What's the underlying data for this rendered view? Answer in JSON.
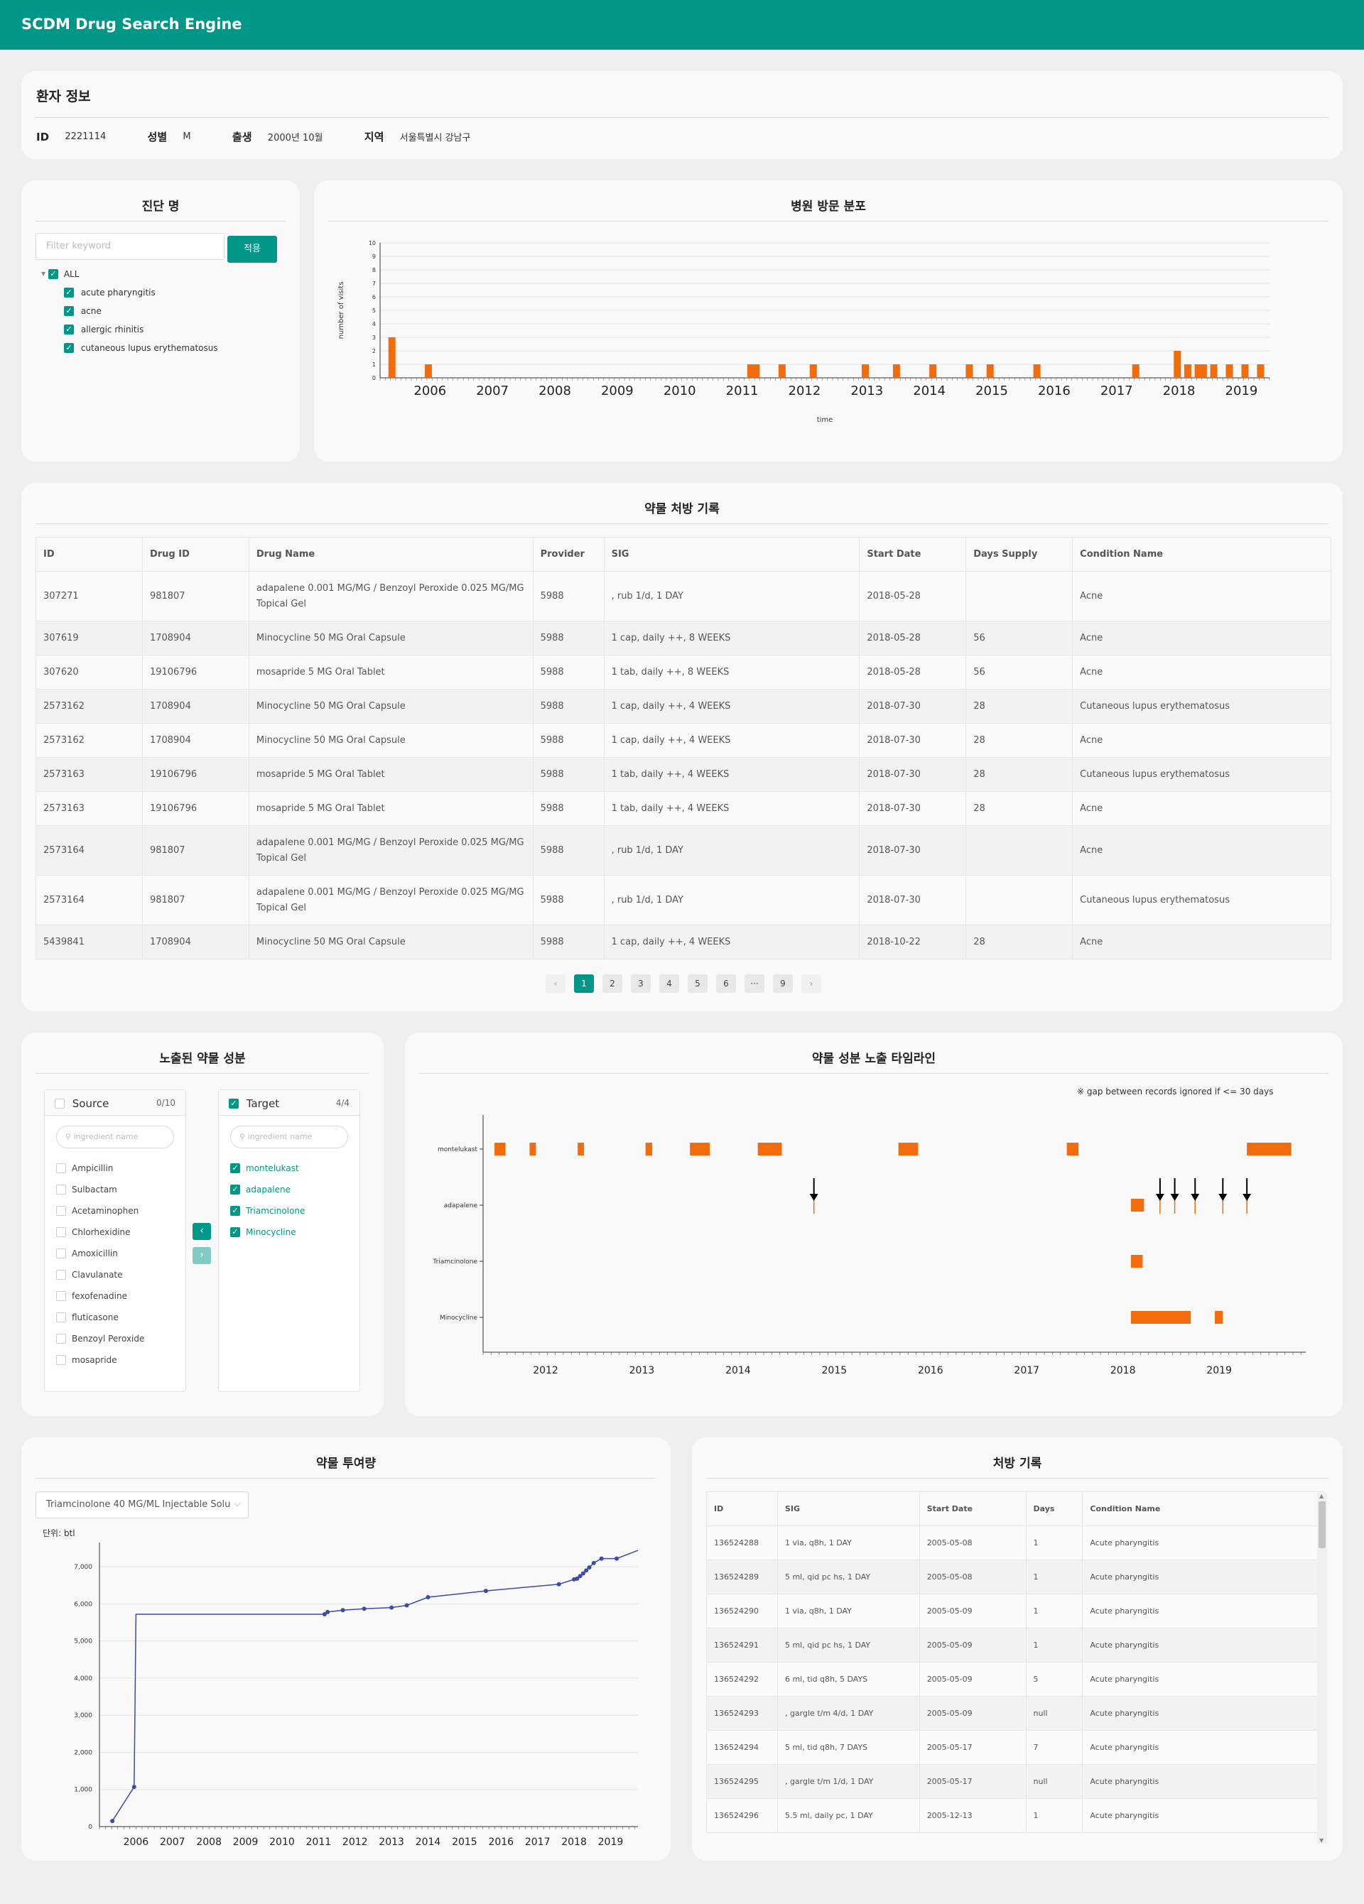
{
  "app": {
    "title": "SCDM Drug Search Engine"
  },
  "patient": {
    "title": "환자 정보",
    "id_label": "ID",
    "id": "2221114",
    "sex_label": "성별",
    "sex": "M",
    "birth_label": "출생",
    "birth": "2000년 10월",
    "region_label": "지역",
    "region": "서울특별시 강남구"
  },
  "diagnosis": {
    "title": "진단 명",
    "filter_placeholder": "Filter keyword",
    "apply_label": "적용",
    "all_label": "ALL",
    "items": [
      "acute pharyngitis",
      "acne",
      "allergic rhinitis",
      "cutaneous lupus erythematosus"
    ]
  },
  "visits": {
    "title": "병원 방문 분포"
  },
  "prescriptions": {
    "title": "약물 처방 기록",
    "columns": [
      "ID",
      "Drug ID",
      "Drug Name",
      "Provider",
      "SIG",
      "Start Date",
      "Days Supply",
      "Condition Name"
    ],
    "rows": [
      [
        "307271",
        "981807",
        "adapalene 0.001 MG/MG / Benzoyl Peroxide 0.025 MG/MG Topical Gel",
        "5988",
        ", rub 1/d, 1 DAY",
        "2018-05-28",
        "",
        "Acne"
      ],
      [
        "307619",
        "1708904",
        "Minocycline 50 MG Oral Capsule",
        "5988",
        "1 cap, daily ++, 8 WEEKS",
        "2018-05-28",
        "56",
        "Acne"
      ],
      [
        "307620",
        "19106796",
        "mosapride 5 MG Oral Tablet",
        "5988",
        "1 tab, daily ++, 8 WEEKS",
        "2018-05-28",
        "56",
        "Acne"
      ],
      [
        "2573162",
        "1708904",
        "Minocycline 50 MG Oral Capsule",
        "5988",
        "1 cap, daily ++, 4 WEEKS",
        "2018-07-30",
        "28",
        "Cutaneous lupus erythematosus"
      ],
      [
        "2573162",
        "1708904",
        "Minocycline 50 MG Oral Capsule",
        "5988",
        "1 cap, daily ++, 4 WEEKS",
        "2018-07-30",
        "28",
        "Acne"
      ],
      [
        "2573163",
        "19106796",
        "mosapride 5 MG Oral Tablet",
        "5988",
        "1 tab, daily ++, 4 WEEKS",
        "2018-07-30",
        "28",
        "Cutaneous lupus erythematosus"
      ],
      [
        "2573163",
        "19106796",
        "mosapride 5 MG Oral Tablet",
        "5988",
        "1 tab, daily ++, 4 WEEKS",
        "2018-07-30",
        "28",
        "Acne"
      ],
      [
        "2573164",
        "981807",
        "adapalene 0.001 MG/MG / Benzoyl Peroxide 0.025 MG/MG Topical Gel",
        "5988",
        ", rub 1/d, 1 DAY",
        "2018-07-30",
        "",
        "Acne"
      ],
      [
        "2573164",
        "981807",
        "adapalene 0.001 MG/MG / Benzoyl Peroxide 0.025 MG/MG Topical Gel",
        "5988",
        ", rub 1/d, 1 DAY",
        "2018-07-30",
        "",
        "Cutaneous lupus erythematosus"
      ],
      [
        "5439841",
        "1708904",
        "Minocycline 50 MG Oral Capsule",
        "5988",
        "1 cap, daily ++, 4 WEEKS",
        "2018-10-22",
        "28",
        "Acne"
      ]
    ],
    "pagination": {
      "prev": "‹",
      "pages": [
        "1",
        "2",
        "3",
        "4",
        "5",
        "6",
        "···",
        "9"
      ],
      "current": "1",
      "next": "›"
    }
  },
  "ingredients": {
    "title": "노출된 약물 성분",
    "source": {
      "label": "Source",
      "count": "0/10",
      "placeholder": "ingredient name",
      "items": [
        "Ampicillin",
        "Sulbactam",
        "Acetaminophen",
        "Chlorhexidine",
        "Amoxicillin",
        "Clavulanate",
        "fexofenadine",
        "fluticasone",
        "Benzoyl Peroxide",
        "mosapride"
      ]
    },
    "target": {
      "label": "Target",
      "count": "4/4",
      "placeholder": "ingredient name",
      "items": [
        "montelukast",
        "adapalene",
        "Triamcinolone",
        "Minocycline"
      ]
    }
  },
  "timeline": {
    "title": "약물 성분 노출 타임라인",
    "note": "※ gap between records ignored if <= 30 days"
  },
  "dosage": {
    "title": "약물 투여량",
    "selected_drug": "Triamcinolone 40 MG/ML Injectable Solu",
    "unit": "단위: btl"
  },
  "history": {
    "title": "처방 기록",
    "columns": [
      "ID",
      "SIG",
      "Start Date",
      "Days",
      "Condition Name"
    ],
    "rows": [
      [
        "136524288",
        "1 via, q8h, 1 DAY",
        "2005-05-08",
        "1",
        "Acute pharyngitis"
      ],
      [
        "136524289",
        "5 ml, qid pc hs, 1 DAY",
        "2005-05-08",
        "1",
        "Acute pharyngitis"
      ],
      [
        "136524290",
        "1 via, q8h, 1 DAY",
        "2005-05-09",
        "1",
        "Acute pharyngitis"
      ],
      [
        "136524291",
        "5 ml, qid pc hs, 1 DAY",
        "2005-05-09",
        "1",
        "Acute pharyngitis"
      ],
      [
        "136524292",
        "6 ml, tid q8h, 5 DAYS",
        "2005-05-09",
        "5",
        "Acute pharyngitis"
      ],
      [
        "136524293",
        ", gargle t/m 4/d, 1 DAY",
        "2005-05-09",
        "null",
        "Acute pharyngitis"
      ],
      [
        "136524294",
        "5 ml, tid q8h, 7 DAYS",
        "2005-05-17",
        "7",
        "Acute pharyngitis"
      ],
      [
        "136524295",
        ", gargle t/m 1/d, 1 DAY",
        "2005-05-17",
        "null",
        "Acute pharyngitis"
      ],
      [
        "136524296",
        "5.5 ml, daily pc, 1 DAY",
        "2005-12-13",
        "1",
        "Acute pharyngitis"
      ]
    ]
  },
  "colors": {
    "header": "#009688",
    "bar": "#f36c0c",
    "line": "#3b4ba6"
  },
  "chart_data": [
    {
      "type": "bar",
      "title": "",
      "xlabel": "time",
      "ylabel": "number of visits",
      "ylim": [
        0,
        10
      ],
      "x_ticks": [
        "2006",
        "2007",
        "2008",
        "2009",
        "2010",
        "2011",
        "2012",
        "2013",
        "2014",
        "2015",
        "2016",
        "2017",
        "2018",
        "2019"
      ],
      "x": [
        "2005-05",
        "2005-12",
        "2011-02",
        "2011-03",
        "2011-08",
        "2012-02",
        "2012-12",
        "2013-06",
        "2014-01",
        "2014-08",
        "2014-12",
        "2015-09",
        "2017-04",
        "2017-12",
        "2018-02",
        "2018-04",
        "2018-05",
        "2018-07",
        "2018-10",
        "2019-01",
        "2019-04"
      ],
      "values": [
        3,
        1,
        1,
        1,
        1,
        1,
        1,
        1,
        1,
        1,
        1,
        1,
        1,
        2,
        1,
        1,
        1,
        1,
        1,
        1,
        1
      ]
    },
    {
      "type": "timeline",
      "title": "",
      "x_ticks": [
        "2012",
        "2013",
        "2014",
        "2015",
        "2016",
        "2017",
        "2018",
        "2019"
      ],
      "categories": [
        "montelukast",
        "adapalene",
        "Triamcinolone",
        "Minocycline"
      ],
      "series": [
        {
          "name": "montelukast",
          "intervals": [
            [
              "2011-06-20",
              "2011-08-01"
            ],
            [
              "2011-11-01",
              "2011-11-25"
            ],
            [
              "2012-05-01",
              "2012-05-25"
            ],
            [
              "2013-01-15",
              "2013-02-10"
            ],
            [
              "2013-07-01",
              "2013-09-15"
            ],
            [
              "2014-03-15",
              "2014-06-15"
            ],
            [
              "2015-09-01",
              "2015-11-15"
            ],
            [
              "2017-06-01",
              "2017-07-15"
            ],
            [
              "2019-04-15",
              "2019-10-01"
            ]
          ]
        },
        {
          "name": "adapalene",
          "intervals": [
            [
              "2018-02-01",
              "2018-03-20"
            ]
          ],
          "markers": [
            "2014-10-15",
            "2018-05-20",
            "2018-07-15",
            "2018-10-01",
            "2019-01-15",
            "2019-04-15"
          ]
        },
        {
          "name": "Triamcinolone",
          "intervals": [
            [
              "2018-02-01",
              "2018-03-15"
            ]
          ]
        },
        {
          "name": "Minocycline",
          "intervals": [
            [
              "2018-02-01",
              "2018-09-15"
            ],
            [
              "2018-12-15",
              "2019-01-15"
            ]
          ]
        }
      ]
    },
    {
      "type": "line",
      "title": "",
      "ylabel": "",
      "unit": "단위: btl",
      "ylim": [
        0,
        7500
      ],
      "y_ticks": [
        "0",
        "1,000",
        "2,000",
        "3,000",
        "4,000",
        "5,000",
        "6,000",
        "7,000"
      ],
      "x_ticks": [
        "2006",
        "2007",
        "2008",
        "2009",
        "2010",
        "2011",
        "2012",
        "2013",
        "2014",
        "2015",
        "2016",
        "2017",
        "2018",
        "2019"
      ],
      "x": [
        "2005-05-08",
        "2005-12-13",
        "2006-01-01",
        "2011-03-01",
        "2011-04-01",
        "2011-09-01",
        "2012-04-01",
        "2013-01-01",
        "2013-06-01",
        "2014-01-01",
        "2015-08-01",
        "2017-08-01",
        "2018-01-01",
        "2018-02-01",
        "2018-03-01",
        "2018-04-01",
        "2018-05-01",
        "2018-06-01",
        "2018-07-15",
        "2018-10-01",
        "2019-03-01",
        "2019-10-01"
      ],
      "values": [
        150,
        1070,
        5720,
        5720,
        5780,
        5830,
        5870,
        5900,
        5960,
        6180,
        6350,
        6530,
        6660,
        6680,
        6750,
        6820,
        6900,
        6980,
        7100,
        7220,
        7220,
        7440
      ]
    }
  ]
}
